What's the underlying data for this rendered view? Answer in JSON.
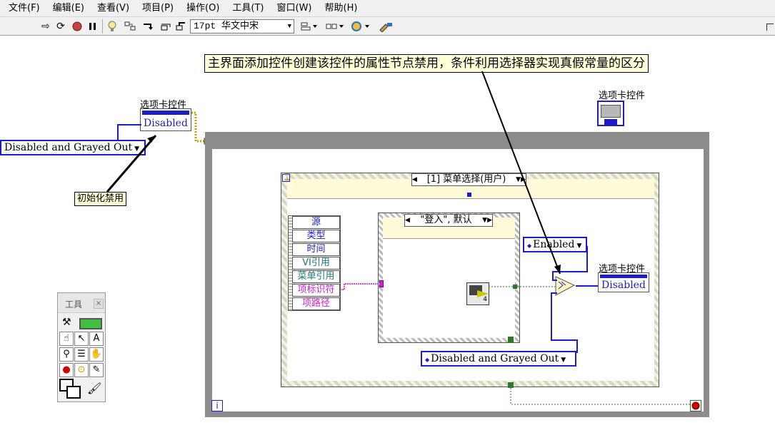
{
  "menu": [
    "文件(F)",
    "编辑(E)",
    "查看(V)",
    "项目(P)",
    "操作(O)",
    "工具(T)",
    "窗口(W)",
    "帮助(H)"
  ],
  "toolbar": {
    "font": "17pt 华文中宋"
  },
  "annotation_top": "主界面添加控件创建该控件的属性节点禁用，条件利用选择器实现真假常量的区分",
  "annotation_init": "初始化禁用",
  "tab_label_left": "选项卡控件",
  "tab_label_right_top": "选项卡控件",
  "tab_label_inner": "选项卡控件",
  "prop_disabled": "Disabled",
  "enum_left": "Disabled and Grayed Out",
  "enum_bottom": "Disabled and Grayed Out",
  "enum_enabled": "Enabled",
  "case_outer": "[1] 菜单选择(用户)",
  "case_inner": "\"登入\", 默认",
  "event_nodes": [
    "源",
    "类型",
    "时间",
    "VI引用",
    "菜单引用",
    "项标识符",
    "项路径"
  ],
  "event_node_colors": [
    "#1c1cc8",
    "#1c1cc8",
    "#1c1cc8",
    "#1a7a7a",
    "#1a7a7a",
    "#d020d0",
    "#d020d0"
  ],
  "loop_index": "i",
  "subvi_num": "4",
  "tools_palette": {
    "title": "工具"
  }
}
